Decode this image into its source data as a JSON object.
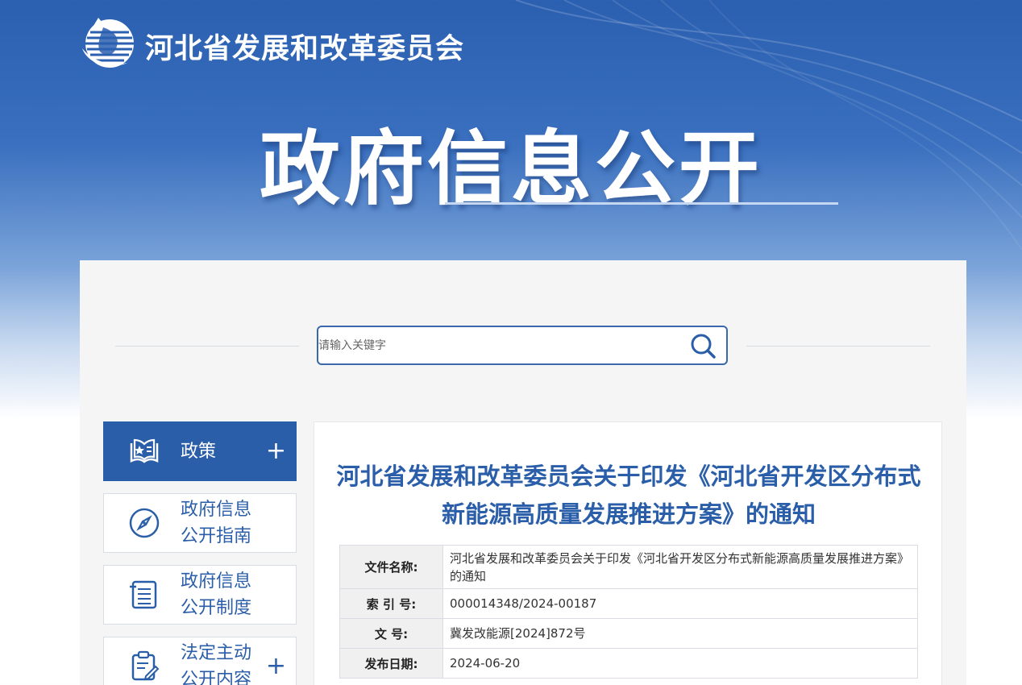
{
  "header": {
    "org_name": "河北省发展和改革委员会",
    "banner_title": "政府信息公开"
  },
  "search": {
    "placeholder": "请输入关键字"
  },
  "sidebar": {
    "items": [
      {
        "label": "政策",
        "icon": "policy-book-star-icon",
        "expandable": true,
        "active": true
      },
      {
        "label": "政府信息公开指南",
        "icon": "compass-icon",
        "expandable": false
      },
      {
        "label": "政府信息公开制度",
        "icon": "list-document-icon",
        "expandable": false
      },
      {
        "label": "法定主动公开内容",
        "icon": "clipboard-edit-icon",
        "expandable": true
      }
    ]
  },
  "document": {
    "title": "河北省发展和改革委员会关于印发《河北省开发区分布式新能源高质量发展推进方案》的通知",
    "meta": [
      {
        "key": "文件名称:",
        "value": "河北省发展和改革委员会关于印发《河北省开发区分布式新能源高质量发展推进方案》的通知"
      },
      {
        "key": "索 引 号:",
        "value": "000014348/2024-00187"
      },
      {
        "key": "文  号:",
        "value": "冀发改能源[2024]872号"
      },
      {
        "key": "发布日期:",
        "value": "2024-06-20"
      }
    ]
  },
  "colors": {
    "brand_blue": "#2b5ea9",
    "banner_blue": "#2b5fb0",
    "panel_bg": "#f5f5f5"
  }
}
